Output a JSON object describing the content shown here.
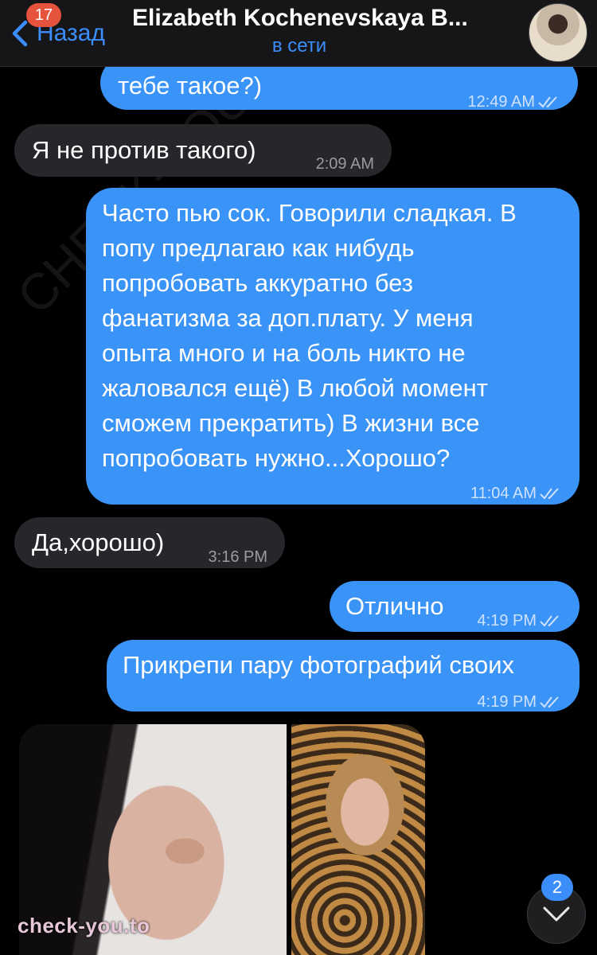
{
  "header": {
    "back_label": "Назад",
    "unread_count": "17",
    "title": "Elizabeth Kochenevskaya B...",
    "status": "в сети"
  },
  "messages": [
    {
      "direction": "out",
      "text": "тебе такое?)",
      "time": "12:49 AM",
      "read": true
    },
    {
      "direction": "in",
      "text": "Я не против такого)",
      "time": "2:09 AM"
    },
    {
      "direction": "out",
      "text": "Часто пью сок. Говорили сладкая. В\nпопу предлагаю как нибудь\nпопробовать аккуратно без\nфанатизма за доп.плату. У меня\nопыта много и на боль никто не\nжаловался ещё) В любой момент\nсможем прекратить) В жизни все\nпопробовать нужно...Хорошо?",
      "time": "11:04 AM",
      "read": true
    },
    {
      "direction": "in",
      "text": "Да,хорошо)",
      "time": "3:16 PM"
    },
    {
      "direction": "out",
      "text": "Отлично",
      "time": "4:19 PM",
      "read": true
    },
    {
      "direction": "out",
      "text": "Прикрепи пару фотографий своих",
      "time": "4:19 PM",
      "read": true
    }
  ],
  "watermark": {
    "bottom": "check-you.to",
    "diagonal": "CHECK-YOU.ME"
  },
  "scroll_down": {
    "badge": "2"
  },
  "colors": {
    "outgoing": "#3a93f6",
    "incoming": "#26272b",
    "accent": "#3a8dfa",
    "badge": "#e5533d"
  }
}
